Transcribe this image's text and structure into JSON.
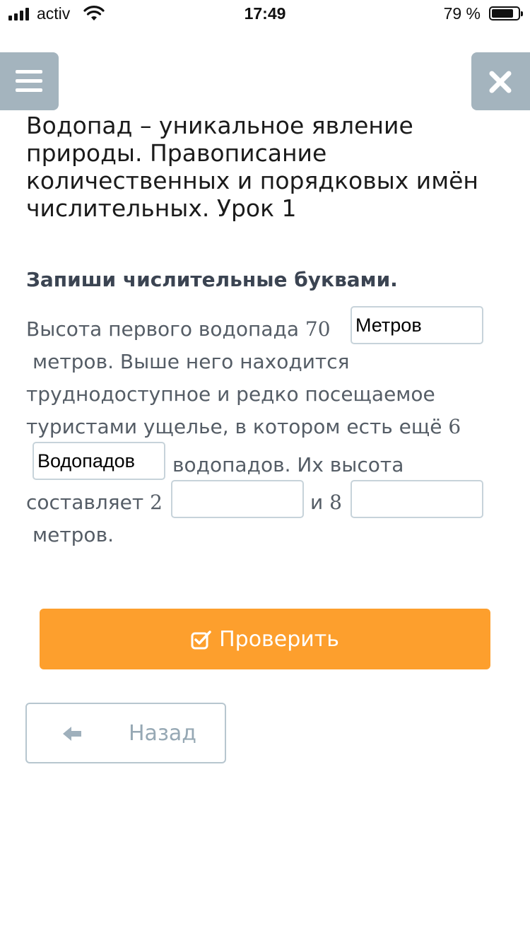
{
  "status_bar": {
    "carrier": "activ",
    "time": "17:49",
    "battery_percent": "79 %"
  },
  "lesson": {
    "title": "Водопад – уникальное явление природы. Правописание количественных и порядковых имён числительных. Урок 1"
  },
  "task": {
    "heading": "Запиши числительные буквами.",
    "text": {
      "part1": "Высота первого водопада",
      "num1": "70",
      "part2": "метров. Выше него находится",
      "part3": "труднодоступное и редко посещаемое",
      "part4": "туристами ущелье, в котором есть ещё",
      "num2": "6",
      "part5": "водопадов. Их высота",
      "part6": "составляет",
      "num3": "2",
      "part7": "и",
      "num4": "8",
      "part8": "метров."
    },
    "answers": {
      "answer1": "Метров",
      "answer2": "Водопадов",
      "answer3": "",
      "answer4": ""
    }
  },
  "buttons": {
    "check_label": "Проверить",
    "back_label": "Назад"
  },
  "colors": {
    "accent": "#fd9f2d",
    "nav_button": "#a4b4be",
    "input_border": "#c7d3da"
  },
  "icons": {
    "menu": "hamburger-icon",
    "close": "close-icon",
    "check": "checkbox-check-icon",
    "back": "arrow-left-icon"
  }
}
